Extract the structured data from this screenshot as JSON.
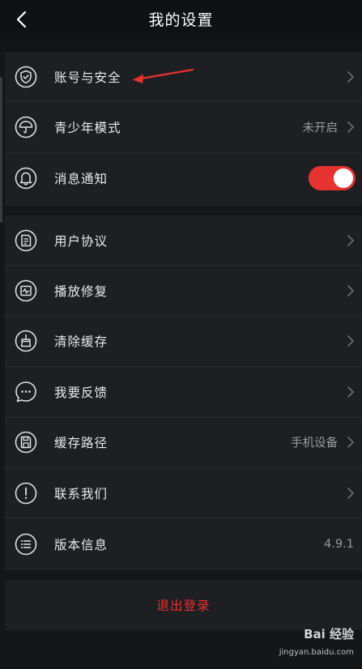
{
  "header": {
    "title": "我的设置",
    "back_icon": "chevron-left-icon"
  },
  "group1": [
    {
      "icon": "shield-check-icon",
      "label": "账号与安全",
      "value": "",
      "control": "chevron"
    },
    {
      "icon": "umbrella-icon",
      "label": "青少年模式",
      "value": "未开启",
      "control": "chevron"
    },
    {
      "icon": "bell-icon",
      "label": "消息通知",
      "value": "",
      "control": "toggle",
      "toggle_on": true
    }
  ],
  "group2": [
    {
      "icon": "document-icon",
      "label": "用户协议",
      "value": "",
      "control": "chevron"
    },
    {
      "icon": "repair-icon",
      "label": "播放修复",
      "value": "",
      "control": "chevron"
    },
    {
      "icon": "broom-icon",
      "label": "清除缓存",
      "value": "",
      "control": "chevron"
    },
    {
      "icon": "chat-bubble-icon",
      "label": "我要反馈",
      "value": "",
      "control": "chevron"
    },
    {
      "icon": "save-disk-icon",
      "label": "缓存路径",
      "value": "手机设备",
      "control": "chevron"
    },
    {
      "icon": "exclamation-icon",
      "label": "联系我们",
      "value": "",
      "control": "chevron"
    },
    {
      "icon": "list-icon",
      "label": "版本信息",
      "value": "4.9.1",
      "control": "none"
    }
  ],
  "logout": {
    "label": "退出登录"
  },
  "colors": {
    "accent": "#e8322f",
    "background": "#151618",
    "row": "#1e1f22"
  },
  "watermark": {
    "main": "Bai 经验",
    "url": "jingyan.baidu.com"
  }
}
